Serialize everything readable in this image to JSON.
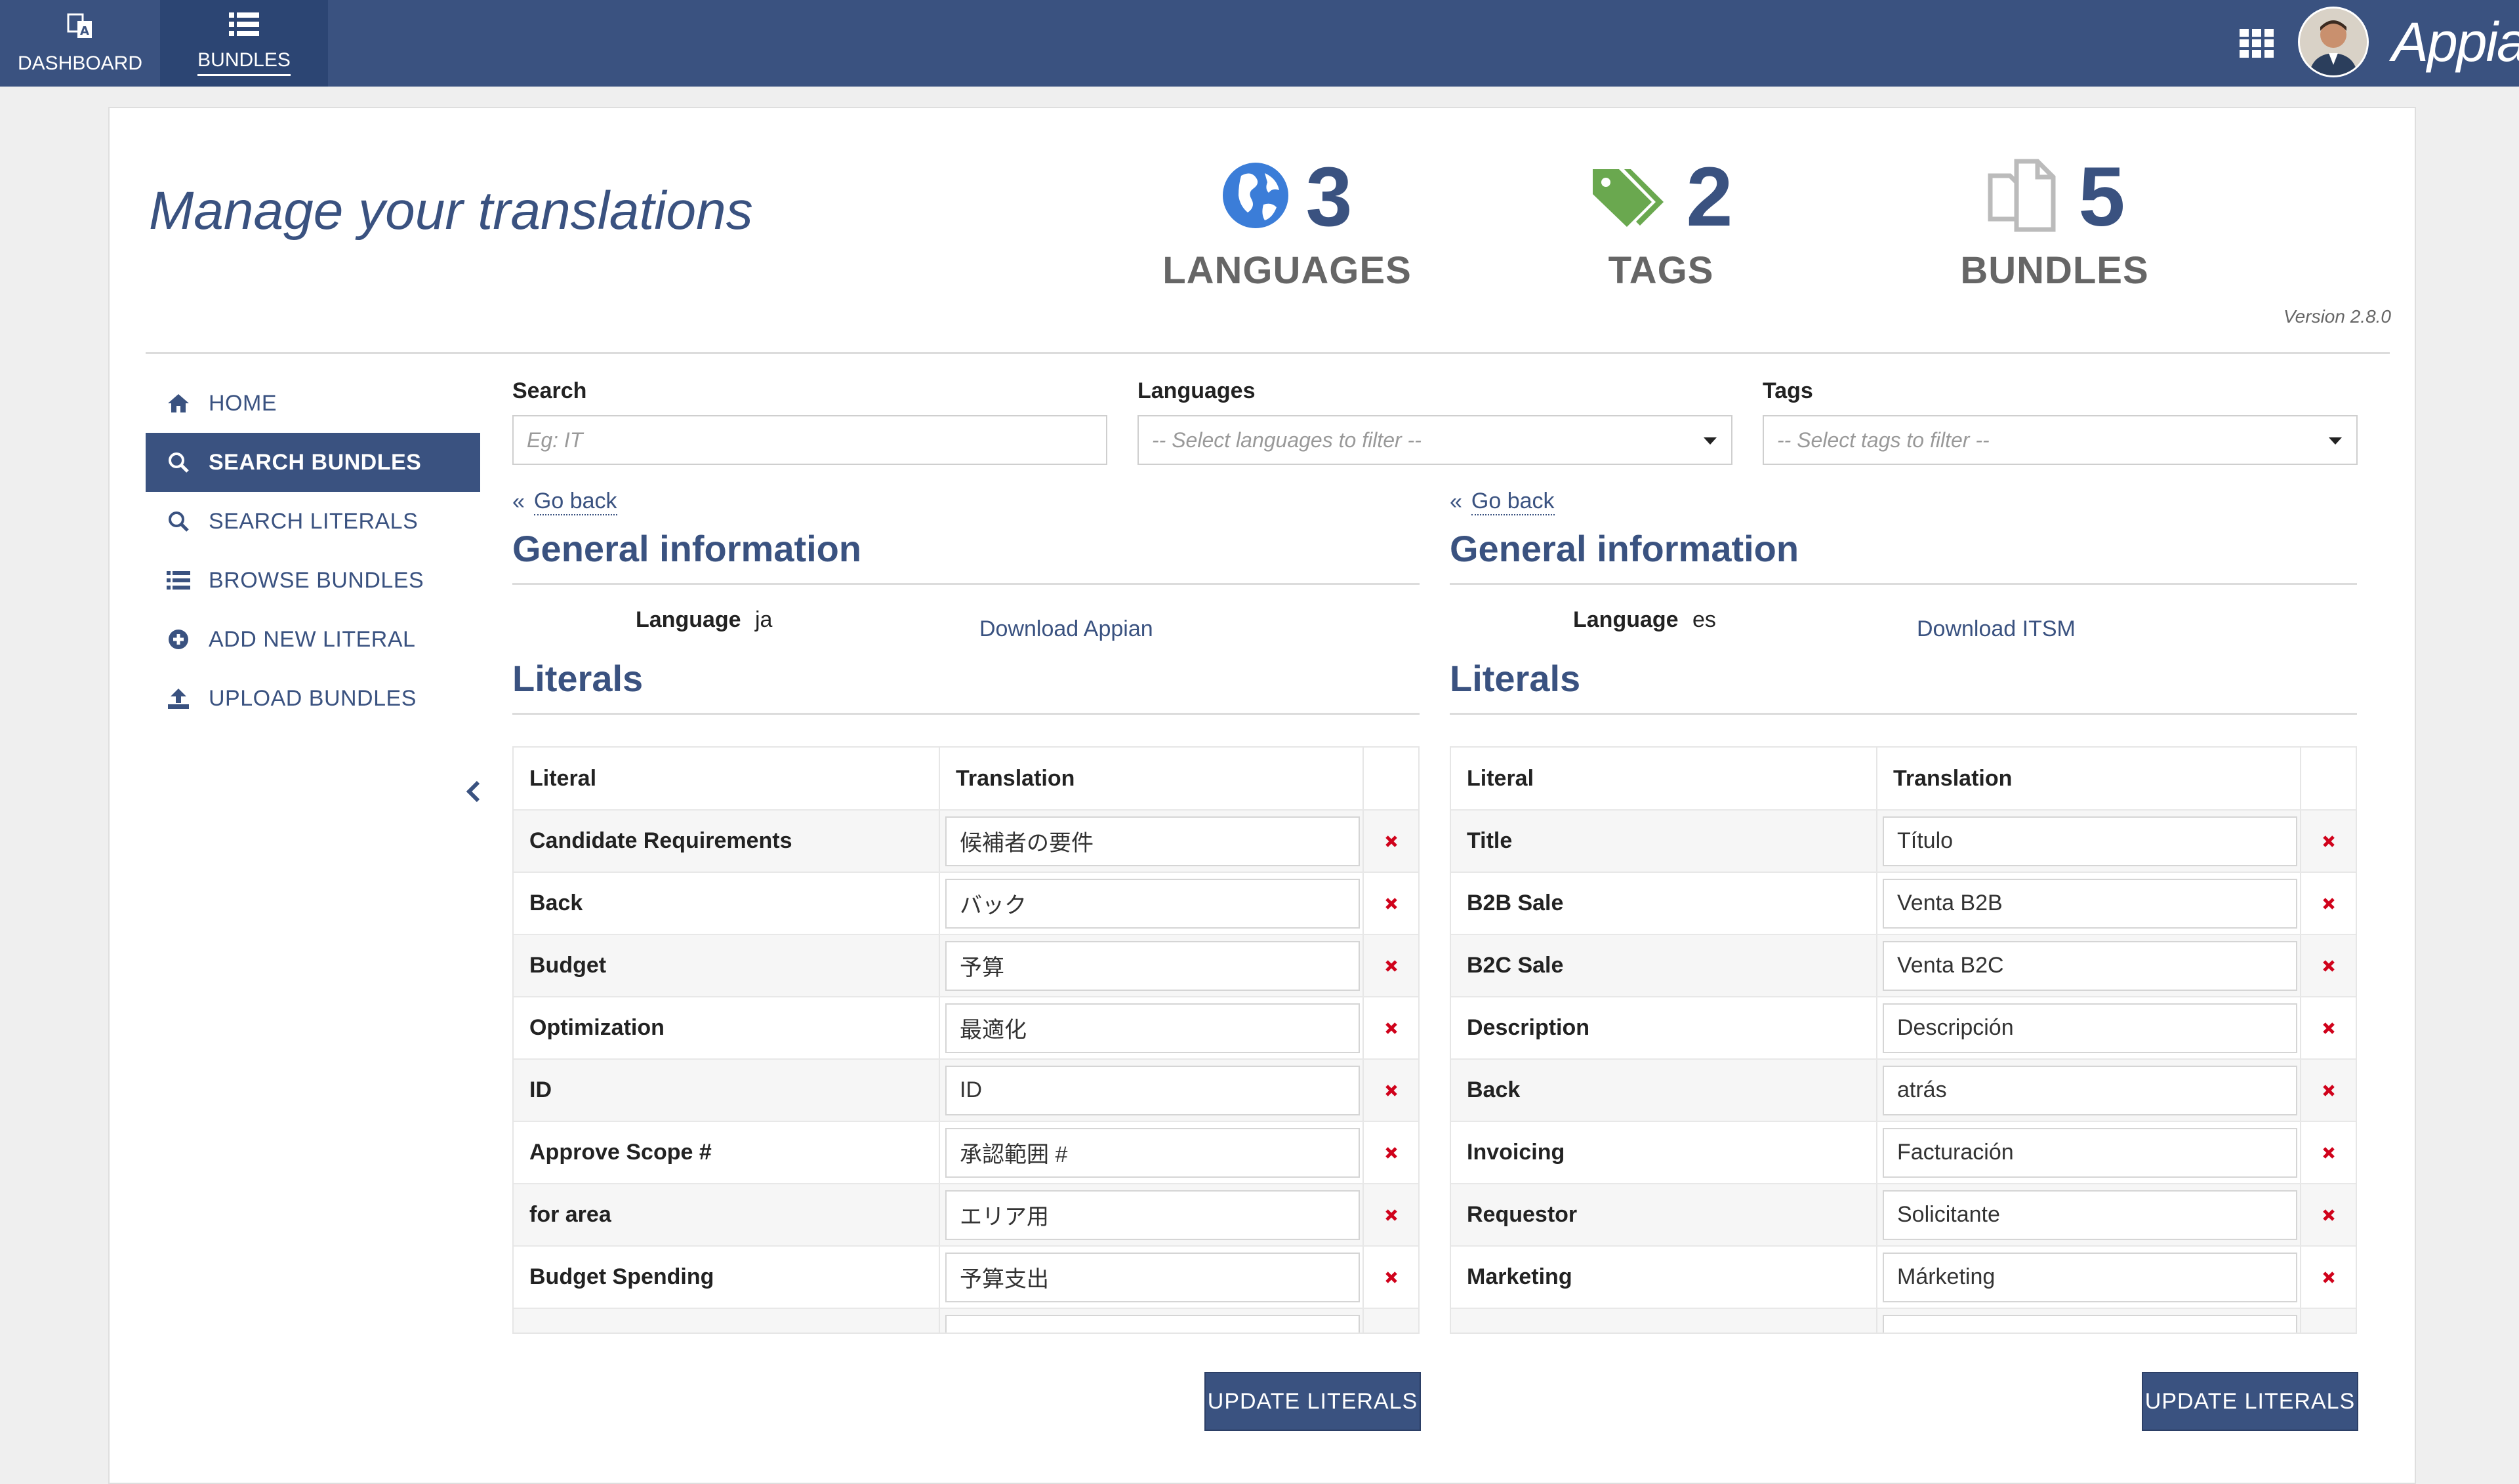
{
  "topbar": {
    "nav": [
      {
        "label": "DASHBOARD",
        "icon": "translate-icon",
        "active": false
      },
      {
        "label": "BUNDLES",
        "icon": "list-icon",
        "active": true
      }
    ],
    "brand": "Appian",
    "apps_icon": "grid-icon",
    "colors": {
      "bar": "#3a5280",
      "active": "#2c4573"
    }
  },
  "header": {
    "title": "Manage your translations",
    "stats": [
      {
        "value": "3",
        "label": "LANGUAGES",
        "icon": "globe-icon"
      },
      {
        "value": "2",
        "label": "TAGS",
        "icon": "tags-icon"
      },
      {
        "value": "5",
        "label": "BUNDLES",
        "icon": "files-icon"
      }
    ],
    "version": "Version 2.8.0"
  },
  "sidebar": {
    "items": [
      {
        "label": "HOME",
        "icon": "home-icon",
        "active": false
      },
      {
        "label": "SEARCH BUNDLES",
        "icon": "search-icon",
        "active": true
      },
      {
        "label": "SEARCH LITERALS",
        "icon": "search-icon",
        "active": false
      },
      {
        "label": "BROWSE BUNDLES",
        "icon": "list-icon",
        "active": false
      },
      {
        "label": "ADD NEW LITERAL",
        "icon": "plus-circle-icon",
        "active": false
      },
      {
        "label": "UPLOAD BUNDLES",
        "icon": "upload-icon",
        "active": false
      }
    ]
  },
  "filters": {
    "search": {
      "label": "Search",
      "placeholder": "Eg: IT"
    },
    "languages": {
      "label": "Languages",
      "placeholder": "-- Select languages to filter --"
    },
    "tags": {
      "label": "Tags",
      "placeholder": "-- Select tags to filter --"
    }
  },
  "panels": [
    {
      "go_back": "Go back",
      "general_title": "General information",
      "language_label": "Language",
      "language_value": "ja",
      "download": "Download Appian",
      "literals_title": "Literals",
      "col_literal": "Literal",
      "col_translation": "Translation",
      "rows": [
        {
          "literal": "Candidate Requirements",
          "translation": "候補者の要件"
        },
        {
          "literal": "Back",
          "translation": "バック"
        },
        {
          "literal": "Budget",
          "translation": "予算"
        },
        {
          "literal": "Optimization",
          "translation": "最適化"
        },
        {
          "literal": "ID",
          "translation": "ID"
        },
        {
          "literal": "Approve Scope #",
          "translation": "承認範囲 #"
        },
        {
          "literal": "for area",
          "translation": "エリア用"
        },
        {
          "literal": "Budget Spending",
          "translation": "予算支出"
        }
      ],
      "update_label": "UPDATE LITERALS"
    },
    {
      "go_back": "Go back",
      "general_title": "General information",
      "language_label": "Language",
      "language_value": "es",
      "download": "Download ITSM",
      "literals_title": "Literals",
      "col_literal": "Literal",
      "col_translation": "Translation",
      "rows": [
        {
          "literal": "Title",
          "translation": "Título"
        },
        {
          "literal": "B2B Sale",
          "translation": "Venta B2B"
        },
        {
          "literal": "B2C Sale",
          "translation": "Venta B2C"
        },
        {
          "literal": "Description",
          "translation": "Descripción"
        },
        {
          "literal": "Back",
          "translation": "atrás"
        },
        {
          "literal": "Invoicing",
          "translation": "Facturación"
        },
        {
          "literal": "Requestor",
          "translation": "Solicitante"
        },
        {
          "literal": "Marketing",
          "translation": "Márketing"
        }
      ],
      "update_label": "UPDATE LITERALS"
    }
  ],
  "colors": {
    "primary": "#3a5280",
    "delete": "#d0021b",
    "tag_green": "#6aa84f",
    "globe_blue": "#3b7dd8"
  }
}
